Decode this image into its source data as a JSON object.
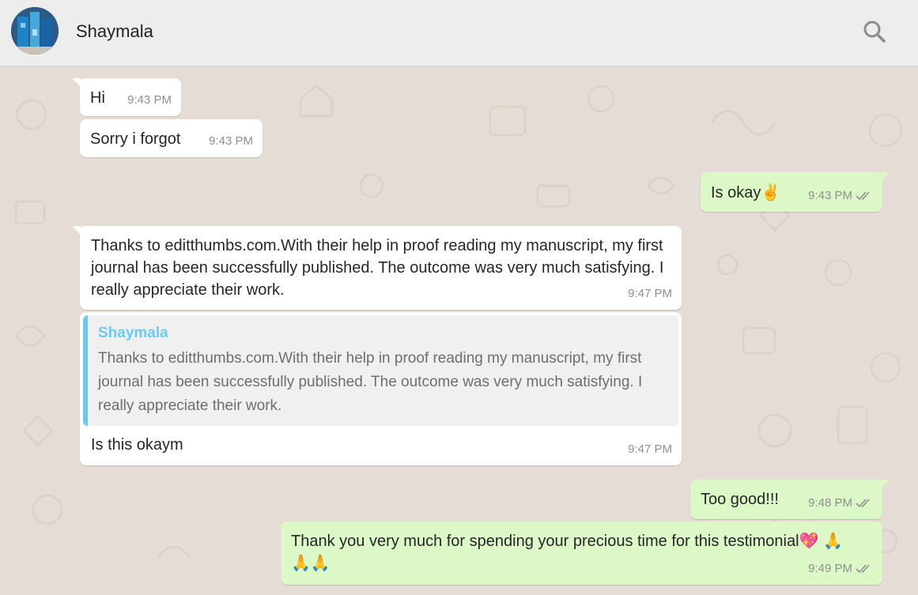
{
  "header": {
    "contact_name": "Shaymala",
    "avatar_icon": "profile-photo",
    "search_icon": "search-icon"
  },
  "theme": {
    "header_bg": "#ededed",
    "chat_bg": "#e5ddd5",
    "incoming_bg": "#ffffff",
    "outgoing_bg": "#dcf8c6",
    "quote_accent": "#6bcbef",
    "read_tick_color": "#8f8f8f"
  },
  "messages": [
    {
      "direction": "in",
      "text": "Hi",
      "time": "9:43 PM"
    },
    {
      "direction": "in",
      "text": "Sorry i forgot",
      "time": "9:43 PM"
    },
    {
      "direction": "out",
      "text": "Is okay✌️",
      "time": "9:43 PM",
      "status": "read"
    },
    {
      "direction": "in",
      "text": "Thanks to editthumbs.com.With their help in proof reading my manuscript, my first journal has been successfully published. The outcome was very much satisfying. I really appreciate their work.",
      "time": "9:47 PM"
    },
    {
      "direction": "in",
      "quote": {
        "author": "Shaymala",
        "text": "Thanks to editthumbs.com.With their help in proof reading my manuscript, my first journal has been successfully published. The outcome was very much satisfying. I really appreciate their work."
      },
      "text": "Is this okaym",
      "time": "9:47 PM"
    },
    {
      "direction": "out",
      "text": "Too good!!!",
      "time": "9:48 PM",
      "status": "read"
    },
    {
      "direction": "out",
      "text": "Thank you very much for spending your precious time for this testimonial💖 🙏🙏🙏",
      "time": "9:49 PM",
      "status": "read"
    }
  ]
}
